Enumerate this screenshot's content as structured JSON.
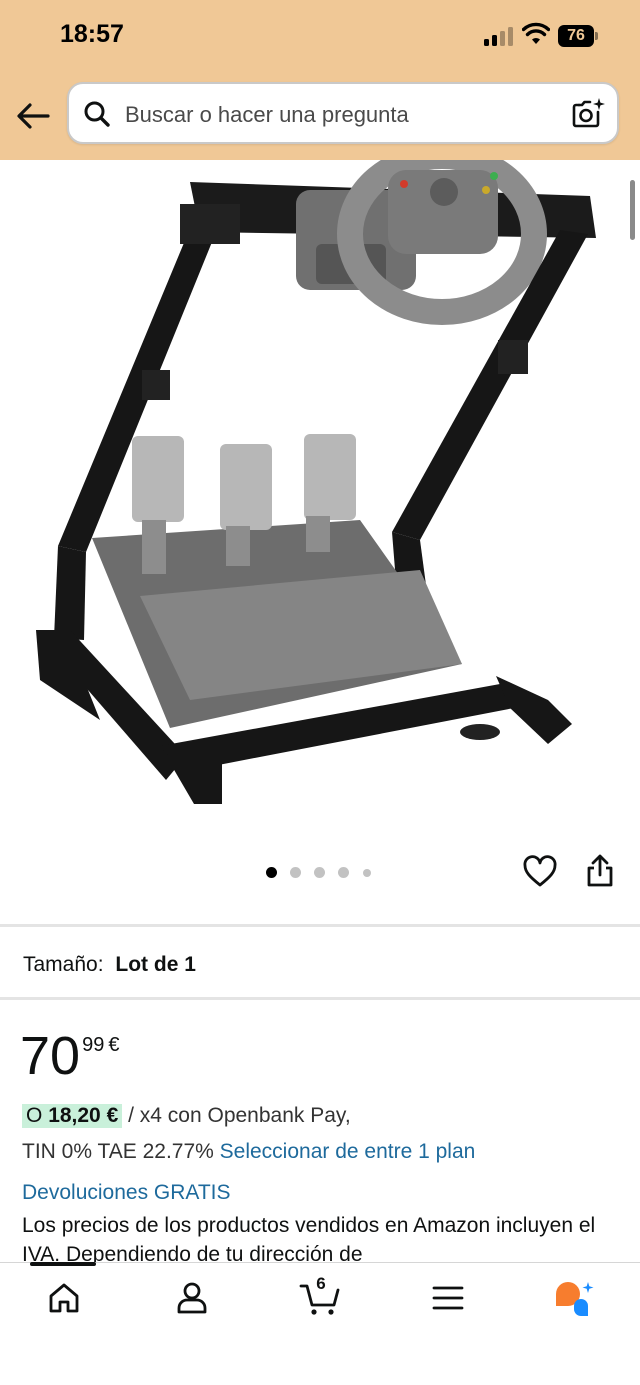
{
  "status_bar": {
    "time": "18:57",
    "battery": "76",
    "icons": [
      "cellular-signal-icon",
      "wifi-icon",
      "battery-icon"
    ]
  },
  "header": {
    "back_icon": "back-arrow-icon",
    "search": {
      "placeholder": "Buscar o hacer una pregunta",
      "value": "",
      "left_icon": "search-icon",
      "right_icon": "camera-search-icon"
    }
  },
  "gallery": {
    "image_count": 5,
    "active_index": 0,
    "actions": [
      "heart-icon",
      "share-icon"
    ]
  },
  "size": {
    "label": "Tamaño:",
    "value": "Lot de 1"
  },
  "price": {
    "whole": "70",
    "fraction": "99",
    "currency": "€"
  },
  "financing": {
    "prefix": "O",
    "amount": "18,20 €",
    "text": "/ x4 con Openbank Pay,",
    "tin_text": "TIN 0% TAE 22.77%",
    "plan_link": "Seleccionar de entre 1 plan"
  },
  "returns": {
    "link": "Devoluciones GRATIS"
  },
  "disclaimer": "Los precios de los productos vendidos en Amazon incluyen el IVA. Dependiendo de tu dirección de",
  "bottom_nav": {
    "items": [
      "home-icon",
      "account-icon",
      "cart-icon",
      "menu-icon",
      "assistant-icon"
    ],
    "cart_count": "6",
    "active_index": 0
  },
  "colors": {
    "header_bg": "#f0c896",
    "link": "#1e6a9c",
    "installment_badge": "#c9f0da",
    "assistant_orange": "#f77d2e",
    "assistant_blue": "#1a8cff"
  }
}
